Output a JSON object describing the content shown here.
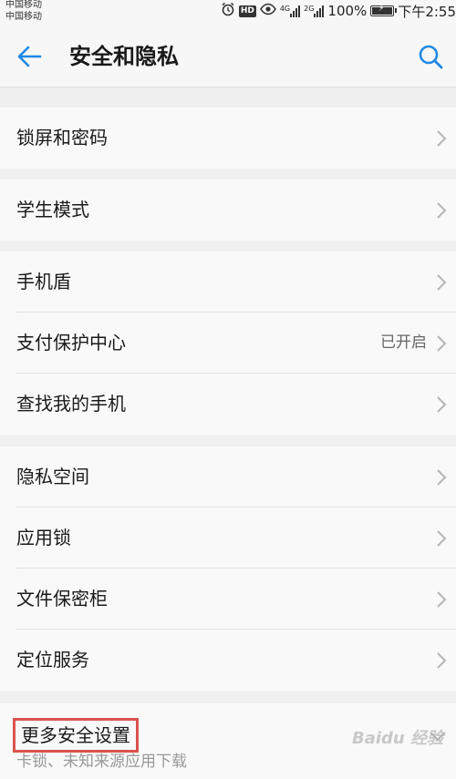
{
  "status_bar": {
    "carrier_1": "中国移动",
    "carrier_2": "中国移动",
    "hd": "HD",
    "net_1": "4G",
    "net_2": "2G",
    "battery": "100%",
    "time": "下午2:55",
    "icons": [
      "alarm-icon",
      "hd-icon",
      "eye-icon",
      "signal-icon",
      "signal-icon",
      "battery-icon"
    ]
  },
  "app_bar": {
    "title": "安全和隐私",
    "back_icon": "back-arrow-icon",
    "search_icon": "search-icon",
    "accent_color": "#1e88e5"
  },
  "groups": [
    {
      "items": [
        {
          "label": "锁屏和密码",
          "value": ""
        }
      ]
    },
    {
      "items": [
        {
          "label": "学生模式",
          "value": ""
        }
      ]
    },
    {
      "items": [
        {
          "label": "手机盾",
          "value": ""
        },
        {
          "label": "支付保护中心",
          "value": "已开启"
        },
        {
          "label": "查找我的手机",
          "value": ""
        }
      ]
    },
    {
      "items": [
        {
          "label": "隐私空间",
          "value": ""
        },
        {
          "label": "应用锁",
          "value": ""
        },
        {
          "label": "文件保密柜",
          "value": ""
        },
        {
          "label": "定位服务",
          "value": ""
        }
      ]
    }
  ],
  "more": {
    "title": "更多安全设置",
    "subtitle": "卡锁、未知来源应用下载",
    "highlight_color": "#d9534f",
    "watermark": "Baidu 经验"
  }
}
